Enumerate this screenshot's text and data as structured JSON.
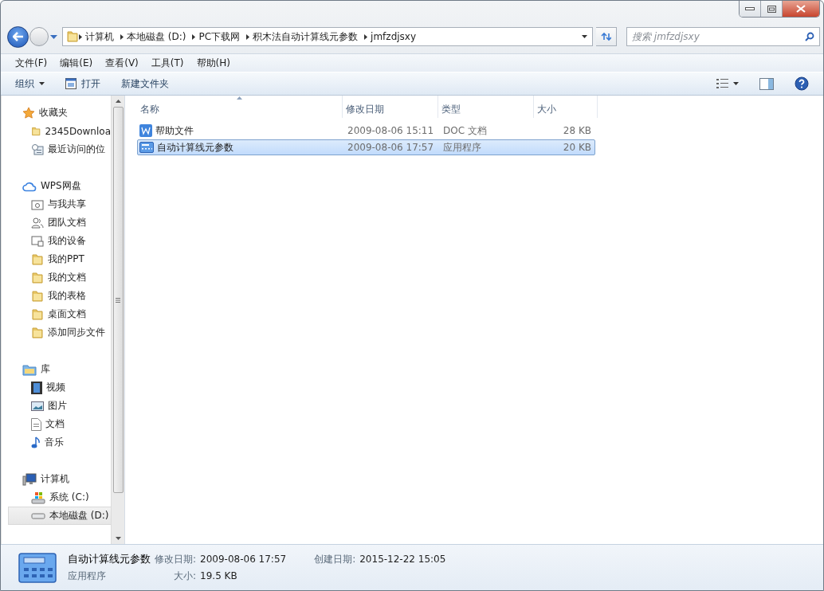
{
  "address": {
    "crumbs": [
      "计算机",
      "本地磁盘 (D:)",
      "PC下载网",
      "积木法自动计算线元参数",
      "jmfzdjsxy"
    ]
  },
  "search": {
    "placeholder": "搜索 jmfzdjsxy"
  },
  "menu": [
    "文件(F)",
    "编辑(E)",
    "查看(V)",
    "工具(T)",
    "帮助(H)"
  ],
  "toolbar": [
    {
      "label": "组织",
      "kind": "dropdown"
    },
    {
      "label": "打开",
      "kind": "open"
    },
    {
      "label": "新建文件夹",
      "kind": "plain"
    }
  ],
  "sidebar": {
    "groups": [
      {
        "label": "收藏夹",
        "kind": "star",
        "selected": false,
        "children": [
          {
            "label": "2345Downloa",
            "kind": "folder",
            "selected": false
          },
          {
            "label": "最近访问的位",
            "kind": "recent",
            "selected": false
          }
        ]
      },
      {
        "label": "WPS网盘",
        "kind": "cloud",
        "selected": false,
        "children": [
          {
            "label": "与我共享",
            "kind": "share",
            "selected": false
          },
          {
            "label": "团队文档",
            "kind": "team",
            "selected": false
          },
          {
            "label": "我的设备",
            "kind": "device",
            "selected": false
          },
          {
            "label": "我的PPT",
            "kind": "folder",
            "selected": false
          },
          {
            "label": "我的文档",
            "kind": "folder",
            "selected": false
          },
          {
            "label": "我的表格",
            "kind": "folder",
            "selected": false
          },
          {
            "label": "桌面文档",
            "kind": "folder",
            "selected": false
          },
          {
            "label": "添加同步文件",
            "kind": "folder",
            "selected": false
          }
        ]
      },
      {
        "label": "库",
        "kind": "library",
        "selected": false,
        "children": [
          {
            "label": "视频",
            "kind": "video",
            "selected": false
          },
          {
            "label": "图片",
            "kind": "picture",
            "selected": false
          },
          {
            "label": "文档",
            "kind": "document",
            "selected": false
          },
          {
            "label": "音乐",
            "kind": "music",
            "selected": false
          }
        ]
      },
      {
        "label": "计算机",
        "kind": "computer",
        "selected": false,
        "children": [
          {
            "label": "系统 (C:)",
            "kind": "system-drive",
            "selected": false
          },
          {
            "label": "本地磁盘 (D:)",
            "kind": "drive",
            "selected": true
          }
        ]
      }
    ]
  },
  "table": {
    "columns": [
      {
        "label": "名称",
        "sorted": true
      },
      {
        "label": "修改日期",
        "sorted": false
      },
      {
        "label": "类型",
        "sorted": false
      },
      {
        "label": "大小",
        "sorted": false
      }
    ],
    "rows": [
      {
        "name": "帮助文件",
        "date": "2009-08-06 15:11",
        "type": "DOC 文档",
        "size": "28 KB",
        "kind": "doc",
        "selected": false
      },
      {
        "name": "自动计算线元参数",
        "date": "2009-08-06 17:57",
        "type": "应用程序",
        "size": "20 KB",
        "kind": "app",
        "selected": true
      }
    ]
  },
  "details": {
    "name": "自动计算线元参数",
    "type": "应用程序",
    "kind": "app",
    "fields": [
      {
        "label": "修改日期:",
        "value": "2009-08-06 17:57"
      },
      {
        "label": "大小:",
        "value": "19.5 KB"
      },
      {
        "label": "创建日期:",
        "value": "2015-12-22 15:05"
      }
    ]
  }
}
